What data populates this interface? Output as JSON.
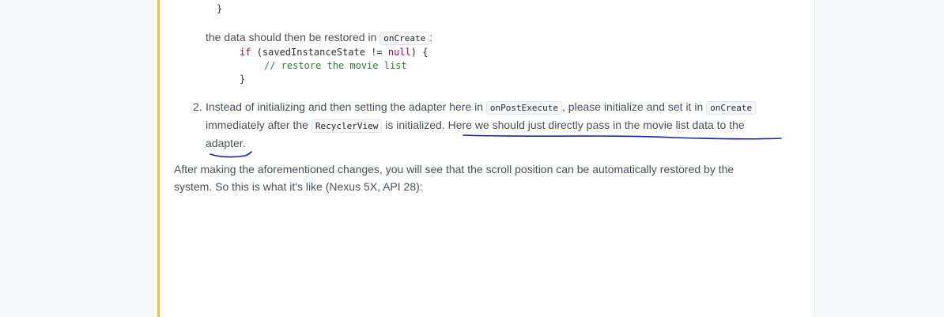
{
  "top_code": {
    "closing_brace": "}"
  },
  "restore_text": {
    "prefix": "the data should then be restored in ",
    "code": "onCreate",
    "suffix": ":"
  },
  "restore_code": {
    "line1_kw": "if",
    "line1_mid": " (savedInstanceState != ",
    "line1_null": "null",
    "line1_end": ") {",
    "line2": "// restore the movie list",
    "line3": "}"
  },
  "list_item_2": {
    "number": "2.",
    "t1": "Instead of initializing and then setting the adapter here in ",
    "code1": "onPostExecute",
    "t2": ", please initialize and set it in ",
    "code2": "onCreate",
    "t3": "immediately after the ",
    "code3": "RecyclerView",
    "t4": " is initialized. Here we should just directly pass in the movie list data to the",
    "t5": "adapter."
  },
  "paragraph": {
    "line1": "After making the aforementioned changes, you will see that the scroll position can be automatically restored by the",
    "line2": "system. So this is what it's like (Nexus 5X, API 28):"
  },
  "colors": {
    "accent_border": "#f2c230",
    "annotation_ink": "#1020c8"
  }
}
